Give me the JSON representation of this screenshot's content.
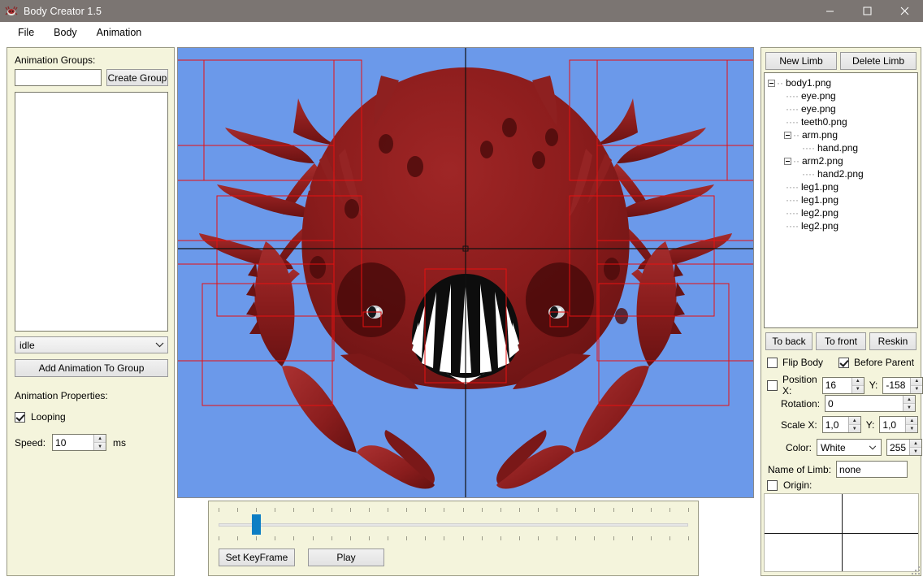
{
  "window": {
    "title": "Body Creator 1.5",
    "icon": "app-creature-icon",
    "minimize": "—",
    "maximize": "☐",
    "close": "✕"
  },
  "menubar": {
    "items": [
      {
        "label": "File"
      },
      {
        "label": "Body"
      },
      {
        "label": "Animation"
      }
    ]
  },
  "left_panel": {
    "animation_groups_label": "Animation Groups:",
    "group_name_value": "",
    "group_name_placeholder": "",
    "create_group_label": "Create Group",
    "groups_list": [],
    "animation_select": {
      "value": "idle",
      "options": [
        "idle"
      ]
    },
    "add_animation_label": "Add Animation To Group",
    "animation_properties_label": "Animation Properties:",
    "looping": {
      "label": "Looping",
      "checked": true
    },
    "speed": {
      "label": "Speed:",
      "value": "10",
      "unit": "ms"
    }
  },
  "canvas": {
    "background_color": "#6b99ea",
    "guide_color": "#1a1a1a",
    "selection_color": "#e81010",
    "creature_color": "#8c1b1b",
    "creature_name": "crab-creature-sprite"
  },
  "timeline": {
    "set_keyframe_label": "Set KeyFrame",
    "play_label": "Play",
    "slider_value": 2,
    "slider_min": 0,
    "slider_max": 100,
    "tick_count": 26
  },
  "right_panel": {
    "new_limb_label": "New Limb",
    "delete_limb_label": "Delete Limb",
    "tree": [
      {
        "label": "body1.png",
        "depth": 0,
        "expandable": true
      },
      {
        "label": "eye.png",
        "depth": 1,
        "expandable": false
      },
      {
        "label": "eye.png",
        "depth": 1,
        "expandable": false
      },
      {
        "label": "teeth0.png",
        "depth": 1,
        "expandable": false
      },
      {
        "label": "arm.png",
        "depth": 1,
        "expandable": true
      },
      {
        "label": "hand.png",
        "depth": 2,
        "expandable": false
      },
      {
        "label": "arm2.png",
        "depth": 1,
        "expandable": true
      },
      {
        "label": "hand2.png",
        "depth": 2,
        "expandable": false
      },
      {
        "label": "leg1.png",
        "depth": 1,
        "expandable": false
      },
      {
        "label": "leg1.png",
        "depth": 1,
        "expandable": false
      },
      {
        "label": "leg2.png",
        "depth": 1,
        "expandable": false
      },
      {
        "label": "leg2.png",
        "depth": 1,
        "expandable": false
      }
    ],
    "to_back_label": "To back",
    "to_front_label": "To front",
    "reskin_label": "Reskin",
    "flip_body": {
      "label": "Flip Body",
      "checked": false
    },
    "before_parent": {
      "label": "Before Parent",
      "checked": true
    },
    "position": {
      "checked": false,
      "x_label": "Position X:",
      "x_value": "16",
      "y_label": "Y:",
      "y_value": "-158"
    },
    "rotation": {
      "label": "Rotation:",
      "value": "0"
    },
    "scale": {
      "x_label": "Scale X:",
      "x_value": "1,0",
      "y_label": "Y:",
      "y_value": "1,0"
    },
    "color": {
      "label": "Color:",
      "value": "White",
      "options": [
        "White"
      ],
      "alpha": "255"
    },
    "name_of_limb": {
      "label": "Name of Limb:",
      "value": "none"
    },
    "origin": {
      "label": "Origin:",
      "checked": false
    }
  }
}
